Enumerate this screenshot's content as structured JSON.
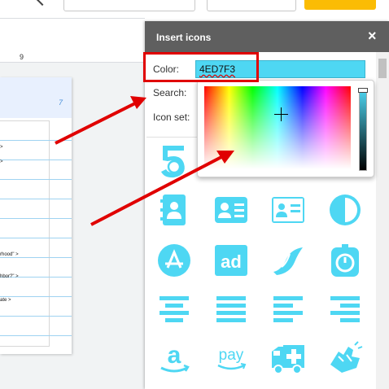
{
  "panel": {
    "title": "Insert icons",
    "close_label": "×",
    "color_label": "Color:",
    "color_value": "4ED7F3",
    "search_label": "Search:",
    "iconset_label": "Icon set:"
  },
  "doc": {
    "ruler_number": "9",
    "page_number": "7",
    "lines": [
      ">",
      ">",
      "rhood\" >",
      "hbor?\" >",
      "ate >"
    ]
  },
  "icons": [
    "five-badge-icon",
    "address-book-icon",
    "contact-card-icon",
    "id-card-icon",
    "adjust-contrast-icon",
    "app-store-icon",
    "ad-icon",
    "wave-leaf-icon",
    "stopwatch-icon",
    "align-center-icon",
    "align-justify-icon",
    "align-left-icon",
    "align-right-icon",
    "amazon-icon",
    "amazon-pay-icon",
    "ambulance-icon",
    "sign-language-icon"
  ],
  "icon_text": {
    "ad": "ad",
    "amazon": "a",
    "pay": "pay"
  },
  "colors": {
    "accent": "#4ED7F3",
    "header": "#5F5F5F",
    "annotation_red": "#E00000"
  }
}
